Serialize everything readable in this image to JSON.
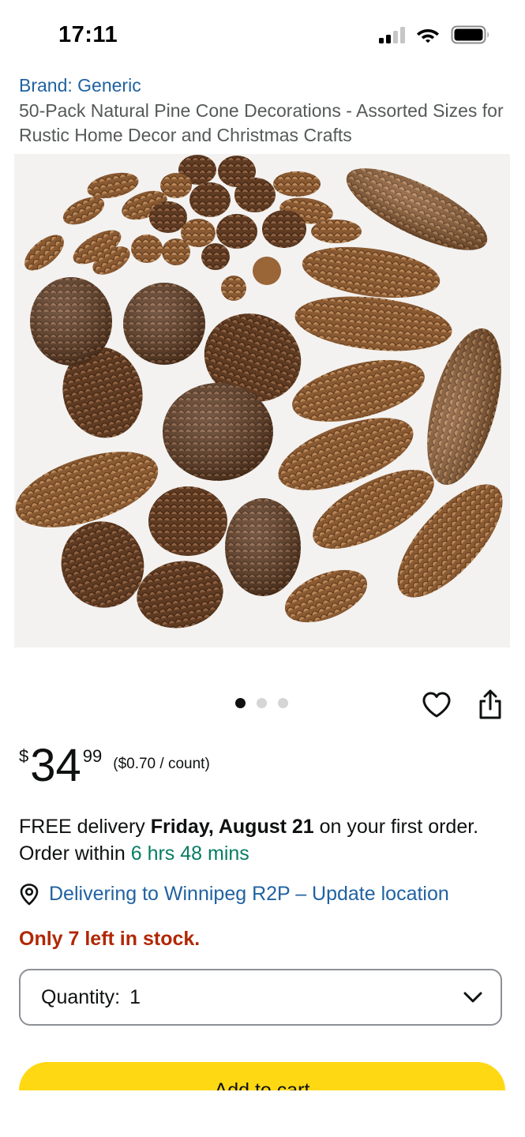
{
  "status_bar": {
    "time": "17:11",
    "icons": [
      "cellular-signal-icon",
      "wifi-icon",
      "battery-icon"
    ]
  },
  "product": {
    "brand": "Brand: Generic",
    "title": "50-Pack Natural Pine Cone Decorations - Assorted Sizes for Rustic Home Decor and Christmas Crafts",
    "image": "pine-cone-product-photo",
    "carousel": {
      "total": 3,
      "active": 1
    }
  },
  "price": {
    "symbol": "$",
    "whole": "34",
    "fraction": "99",
    "unit": "($0.70 / count)"
  },
  "delivery": {
    "prefix": "FREE delivery ",
    "date": "Friday, August 21",
    "middle": " on your first order. Order within ",
    "countdown": "6 hrs 48 mins"
  },
  "location": {
    "text": "Delivering to Winnipeg R2P – Update location"
  },
  "stock": {
    "text": "Only 7 left in stock."
  },
  "quantity": {
    "label": "Quantity:",
    "value": "1"
  },
  "add_to_cart": {
    "label": "Add to cart"
  },
  "colors": {
    "link": "#2162a1",
    "countdown": "#067d62",
    "stock": "#b12704",
    "add_to_cart": "#ffd814",
    "text": "#0f1111",
    "muted": "#565959"
  }
}
